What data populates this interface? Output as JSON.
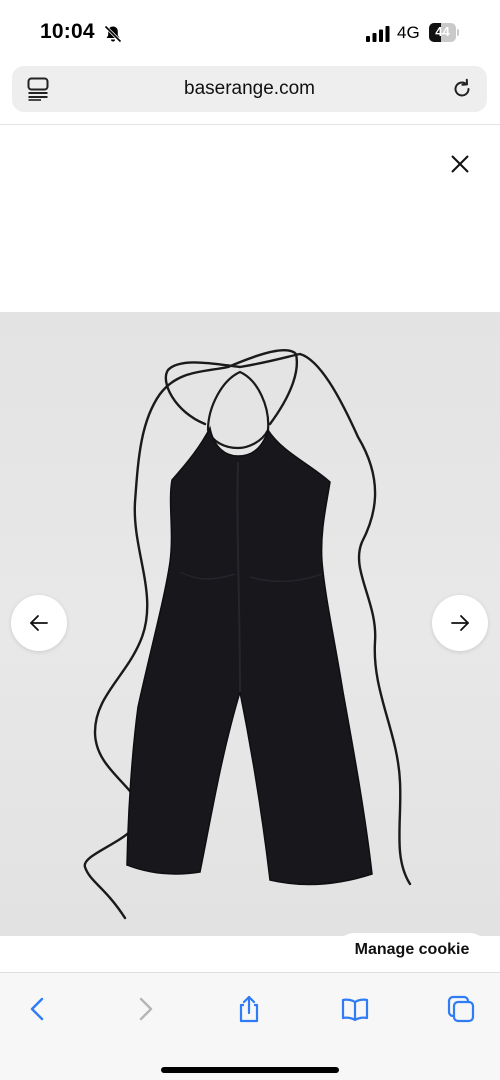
{
  "status_bar": {
    "time": "10:04",
    "network": "4G",
    "battery_percent": "44",
    "battery_level": 0.44,
    "icons": [
      "bell-slash-icon",
      "signal-icon"
    ]
  },
  "browser": {
    "url": "baserange.com",
    "left_icon": "reader-mode-icon",
    "right_icon": "reload-icon"
  },
  "overlay": {
    "close_icon": "close-icon"
  },
  "gallery": {
    "image_subject": "black halter jumpsuit",
    "prev_icon": "arrow-left-icon",
    "next_icon": "arrow-right-icon"
  },
  "cookie": {
    "label": "Manage cookie"
  },
  "toolbar": {
    "items": [
      "back-icon",
      "forward-icon",
      "share-icon",
      "bookmarks-icon",
      "tabs-icon"
    ],
    "accent": "#2f7cf6",
    "disabled": "#b5b5b5"
  }
}
